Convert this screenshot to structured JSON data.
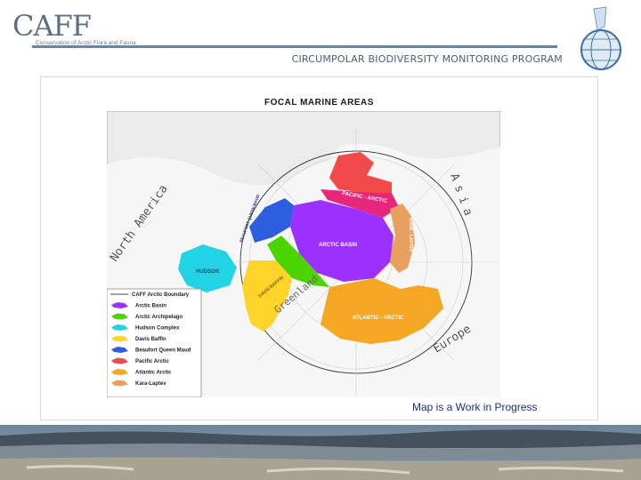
{
  "header": {
    "logo": "CAFF",
    "logo_subtitle": "Conservation of Arctic Flora and Fauna",
    "program": "CIRCUMPOLAR BIODIVERSITY MONITORING PROGRAM"
  },
  "map": {
    "title": "FOCAL MARINE AREAS",
    "continent_labels": [
      "North America",
      "Asia",
      "Europe",
      "Greenland"
    ],
    "area_labels": [
      "PACIFIC - ARCTIC",
      "ARCTIC BASIN",
      "KARA - LAPTEV",
      "ATLANTIC - ARCTIC",
      "HUDSON",
      "DAVIS BAFFIN",
      "BEAUFORT QUEEN MAUD"
    ],
    "legend": {
      "boundary_label": "CAFF Arctic Boundary",
      "items": [
        {
          "label": "Arctic Basin",
          "color": "#9b30ff"
        },
        {
          "label": "Arctic Archipelago",
          "color": "#4cd400"
        },
        {
          "label": "Hudson Complex",
          "color": "#22d3e6"
        },
        {
          "label": "Davis Baffin",
          "color": "#ffd42a"
        },
        {
          "label": "Beaufort Queen Maud",
          "color": "#2b5fe0"
        },
        {
          "label": "Pacific Arctic",
          "color": "#f24a4a"
        },
        {
          "label": "Atlantic Arctic",
          "color": "#f5a623"
        },
        {
          "label": "Kara-Laptev",
          "color": "#e8a060"
        }
      ]
    },
    "note": "Map is a Work in Progress"
  }
}
